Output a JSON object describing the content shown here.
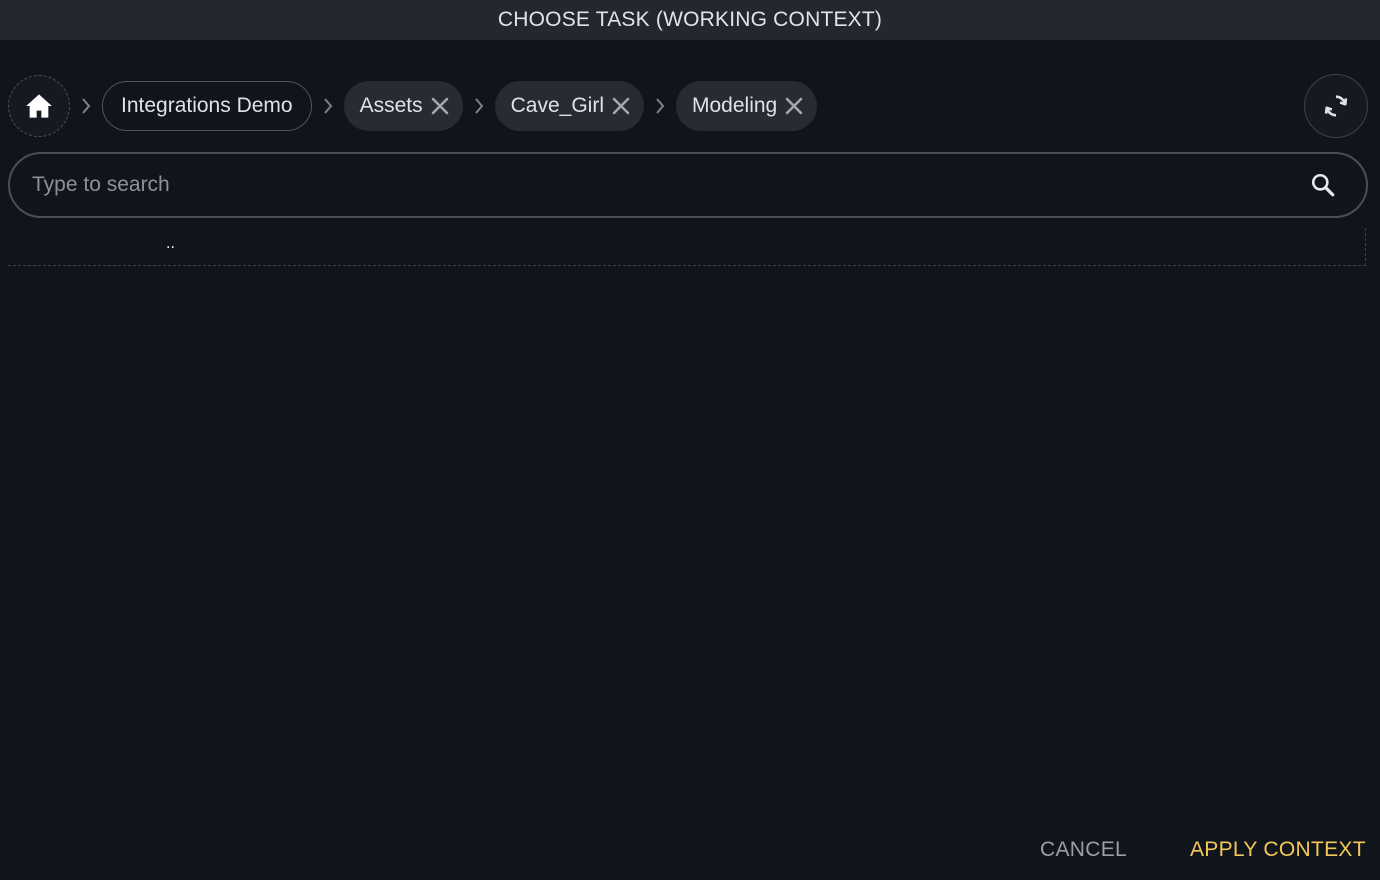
{
  "window": {
    "title": "CHOOSE TASK (WORKING CONTEXT)"
  },
  "breadcrumb": {
    "home_icon": "home-icon",
    "separator_icon": "chevron-right-icon",
    "items": [
      {
        "label": "Integrations Demo",
        "removable": false
      },
      {
        "label": "Assets",
        "removable": true
      },
      {
        "label": "Cave_Girl",
        "removable": true
      },
      {
        "label": "Modeling",
        "removable": true
      }
    ]
  },
  "refresh": {
    "icon": "refresh-icon"
  },
  "search": {
    "placeholder": "Type to search",
    "value": "",
    "icon": "search-icon"
  },
  "list": {
    "items": [
      {
        "label": ".."
      }
    ]
  },
  "footer": {
    "cancel_label": "CANCEL",
    "apply_label": "APPLY CONTEXT"
  },
  "colors": {
    "background": "#10141b",
    "titlebar": "#222730",
    "chip": "#262b34",
    "accent": "#f3c85a"
  }
}
